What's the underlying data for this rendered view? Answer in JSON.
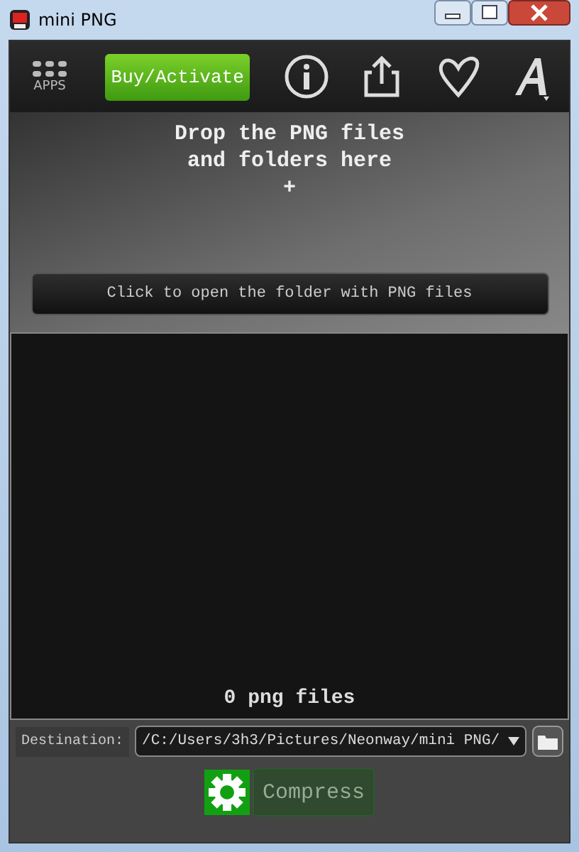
{
  "window": {
    "title": "mini PNG"
  },
  "toolbar": {
    "apps_label": "APPS",
    "buy_button": "Buy/Activate"
  },
  "drop_zone": {
    "lines": [
      "Drop the PNG files",
      "and folders here",
      "+"
    ],
    "open_button": "Click to open the folder with PNG files"
  },
  "file_list": {
    "count": "0 png files"
  },
  "destination": {
    "label": "Destination:",
    "value": "/C:/Users/3h3/Pictures/Neonway/mini PNG/"
  },
  "compress_button": "Compress"
}
